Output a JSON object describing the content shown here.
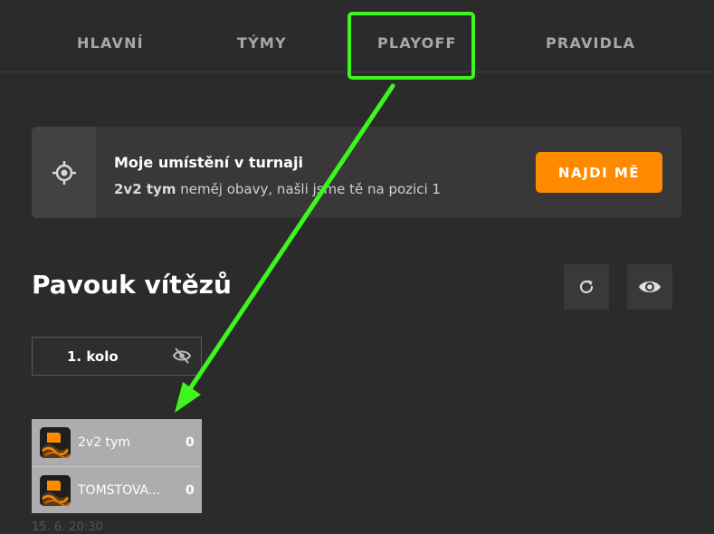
{
  "nav": {
    "items": [
      {
        "label": "HLAVNÍ"
      },
      {
        "label": "TÝMY"
      },
      {
        "label": "PLAYOFF"
      },
      {
        "label": "PRAVIDLA"
      }
    ]
  },
  "placement": {
    "title": "Moje umístění v turnaji",
    "team": "2v2 tym",
    "message": " neměj obavy, našli jsme tě na pozici 1",
    "button": "NAJDI MĚ",
    "icon": "crosshair-icon"
  },
  "bracket": {
    "title": "Pavouk vítězů",
    "refresh_icon": "refresh-icon",
    "view_icon": "eye-icon",
    "round": {
      "label": "1. kolo",
      "icon": "eye-off-icon"
    },
    "match": {
      "teams": [
        {
          "name": "2v2 tym",
          "score": "0"
        },
        {
          "name": "TOMSTOVA...",
          "score": "0"
        }
      ],
      "time": "15. 6. 20:30"
    }
  },
  "colors": {
    "accent": "#ff8a00",
    "highlight": "#3ef51d",
    "background": "#2b2b2b"
  }
}
